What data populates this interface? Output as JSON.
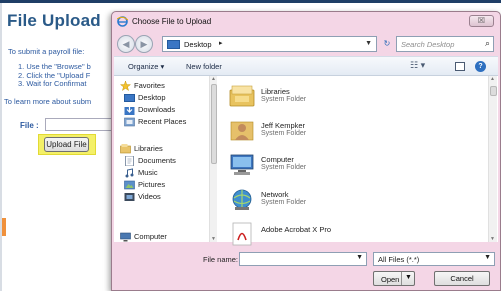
{
  "background_page": {
    "title": "File Upload",
    "intro": "To submit a payroll file:",
    "steps": [
      "1.  Use the \"Browse\" b",
      "2.  Click the \"Upload F",
      "3.  Wait for Confirmat"
    ],
    "learn_more": "To learn more about subm",
    "file_label": "File :",
    "upload_button": "Upload File",
    "colors": {
      "title": "#2a5a88",
      "text": "#2d5aa0",
      "highlight": "#f4f068"
    }
  },
  "dialog": {
    "title": "Choose File to Upload",
    "close_symbol": "☒",
    "address": {
      "location": "Desktop",
      "separator": "▸"
    },
    "search_placeholder": "Search Desktop",
    "toolbar": {
      "organize": "Organize ▾",
      "new_folder": "New folder",
      "view": "☷ ▾"
    },
    "nav_pane": {
      "favorites": {
        "label": "Favorites",
        "items": [
          "Desktop",
          "Downloads",
          "Recent Places"
        ]
      },
      "libraries": {
        "label": "Libraries",
        "items": [
          "Documents",
          "Music",
          "Pictures",
          "Videos"
        ]
      },
      "computer": "Computer"
    },
    "files": [
      {
        "name": "Libraries",
        "type": "System Folder",
        "icon": "library-folder-icon"
      },
      {
        "name": "Jeff Kempker",
        "type": "System Folder",
        "icon": "user-folder-icon"
      },
      {
        "name": "Computer",
        "type": "System Folder",
        "icon": "computer-icon"
      },
      {
        "name": "Network",
        "type": "System Folder",
        "icon": "network-icon"
      },
      {
        "name": "Adobe Acrobat X Pro",
        "type": "",
        "icon": "acrobat-icon"
      }
    ],
    "file_name_label": "File name:",
    "file_name_value": "",
    "file_type": "All Files (*.*)",
    "open_button": "Open",
    "cancel_button": "Cancel",
    "colors": {
      "frame": "#f4d6e6",
      "accent": "#2d6fc0"
    }
  }
}
